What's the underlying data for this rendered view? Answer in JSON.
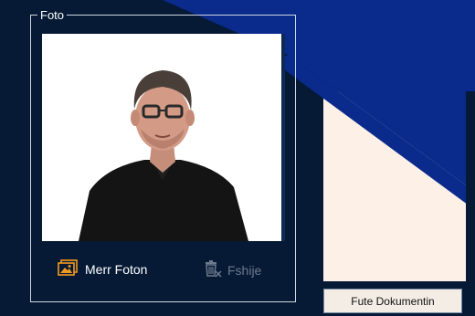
{
  "photo_group": {
    "title": "Foto",
    "get_photo_label": "Merr Foton",
    "delete_label": "Fshije"
  },
  "document": {
    "insert_button_label": "Fute Dokumentin"
  },
  "colors": {
    "background": "#061a36",
    "band": "#0a2a8c",
    "accent_orange": "#f39a1e",
    "disabled_text": "#6d7a8c"
  },
  "icons": {
    "get_photo": "photo-gallery-icon",
    "delete": "trash-icon"
  }
}
